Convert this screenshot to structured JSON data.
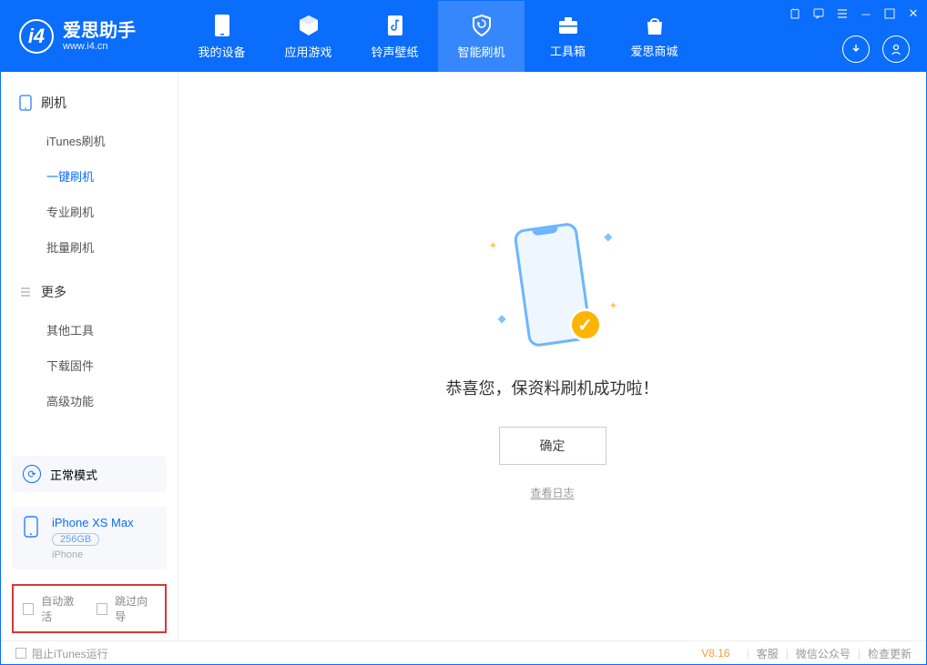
{
  "app": {
    "title": "爱思助手",
    "subtitle": "www.i4.cn"
  },
  "nav": {
    "items": [
      {
        "label": "我的设备"
      },
      {
        "label": "应用游戏"
      },
      {
        "label": "铃声壁纸"
      },
      {
        "label": "智能刷机"
      },
      {
        "label": "工具箱"
      },
      {
        "label": "爱思商城"
      }
    ]
  },
  "sidebar": {
    "section1": {
      "title": "刷机",
      "items": [
        {
          "label": "iTunes刷机"
        },
        {
          "label": "一键刷机"
        },
        {
          "label": "专业刷机"
        },
        {
          "label": "批量刷机"
        }
      ]
    },
    "section2": {
      "title": "更多",
      "items": [
        {
          "label": "其他工具"
        },
        {
          "label": "下载固件"
        },
        {
          "label": "高级功能"
        }
      ]
    },
    "mode": {
      "label": "正常模式"
    },
    "device": {
      "name": "iPhone XS Max",
      "capacity": "256GB",
      "type": "iPhone"
    },
    "checks": {
      "auto_activate": "自动激活",
      "skip_guide": "跳过向导"
    }
  },
  "main": {
    "message": "恭喜您，保资料刷机成功啦！",
    "ok": "确定",
    "view_log": "查看日志"
  },
  "footer": {
    "block_itunes": "阻止iTunes运行",
    "version": "V8.16",
    "links": {
      "service": "客服",
      "wechat": "微信公众号",
      "update": "检查更新"
    }
  }
}
